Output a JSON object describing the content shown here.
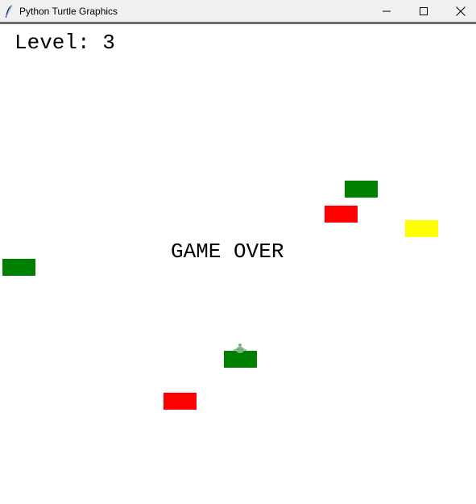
{
  "window": {
    "title": "Python Turtle Graphics",
    "app_icon": "feather-icon",
    "controls": [
      "minimize-icon",
      "maximize-icon",
      "close-icon"
    ]
  },
  "hud": {
    "level_text": "Level: 3"
  },
  "game": {
    "status_text": "GAME OVER",
    "player": {
      "icon": "turtle-icon",
      "color": "#2e7d32"
    },
    "cars": [
      {
        "color": "green"
      },
      {
        "color": "red"
      },
      {
        "color": "yellow"
      },
      {
        "color": "green"
      },
      {
        "color": "green"
      },
      {
        "color": "red"
      }
    ]
  },
  "colors": {
    "green": "#008000",
    "red": "#ff0000",
    "yellow": "#ffff00",
    "titlebar": "#f0f0f0",
    "canvas": "#ffffff"
  }
}
